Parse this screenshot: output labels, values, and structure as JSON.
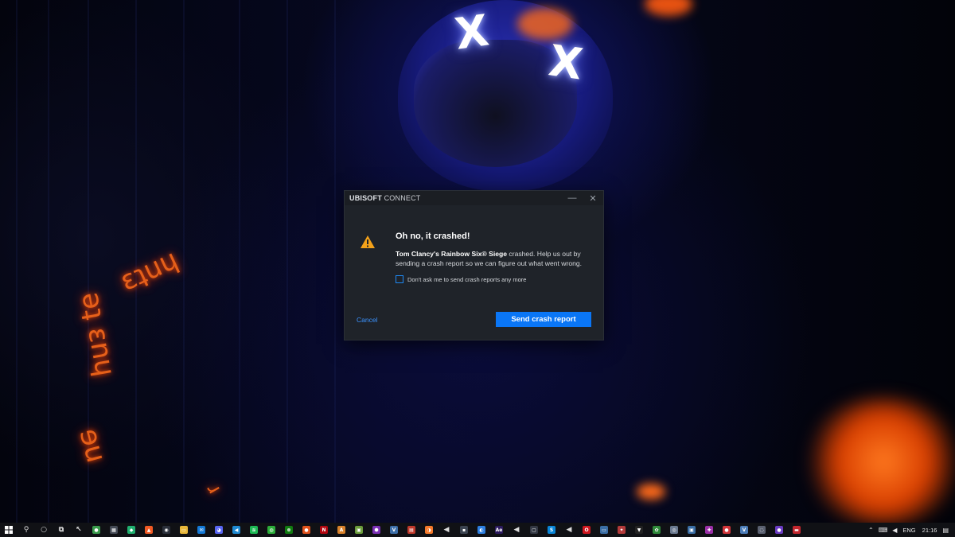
{
  "dialog": {
    "brand_bold": "UBISOFT",
    "brand_rest": " CONNECT",
    "minimize_glyph": "—",
    "close_glyph": "✕",
    "heading": "Oh no, it crashed!",
    "game_name": "Tom Clancy's Rainbow Six® Siege",
    "message_rest": " crashed. Help us out by sending a crash report so we can figure out what went wrong.",
    "checkbox_label": "Don't ask me to send crash reports any more",
    "checkbox_checked": false,
    "cancel_label": "Cancel",
    "send_label": "Send crash report",
    "accent_color": "#0a76f6",
    "warning_color": "#f4a21a"
  },
  "wallpaper": {
    "mask_eye_left": "X",
    "mask_eye_right": "X"
  },
  "taskbar": {
    "apps": [
      {
        "name": "search-icon",
        "glyph": "⚲",
        "color": "transparent"
      },
      {
        "name": "cortana-icon",
        "glyph": "○",
        "color": "transparent"
      },
      {
        "name": "task-view-icon",
        "glyph": "⧉",
        "color": "transparent"
      },
      {
        "name": "cursor-app-icon",
        "glyph": "↖",
        "color": "transparent"
      },
      {
        "name": "chrome-icon",
        "glyph": "●",
        "color": "#3a9b4c"
      },
      {
        "name": "calculator-icon",
        "glyph": "▦",
        "color": "#444a55"
      },
      {
        "name": "app-green-icon",
        "glyph": "◆",
        "color": "#20b070"
      },
      {
        "name": "brave-icon",
        "glyph": "▲",
        "color": "#f15a24"
      },
      {
        "name": "app-eye-icon",
        "glyph": "◉",
        "color": "#2a2f3a"
      },
      {
        "name": "file-explorer-icon",
        "glyph": "▭",
        "color": "#e8b73a"
      },
      {
        "name": "mail-icon",
        "glyph": "✉",
        "color": "#1479d6"
      },
      {
        "name": "discord-icon",
        "glyph": "◕",
        "color": "#5865f2"
      },
      {
        "name": "vscode-icon",
        "glyph": "◀",
        "color": "#1f8ad2"
      },
      {
        "name": "spotify-icon",
        "glyph": "≋",
        "color": "#1db954"
      },
      {
        "name": "xbox-green-icon",
        "glyph": "◍",
        "color": "#2cae3a"
      },
      {
        "name": "xbox-icon",
        "glyph": "⊗",
        "color": "#107c10"
      },
      {
        "name": "app-orange-icon",
        "glyph": "●",
        "color": "#e0521c"
      },
      {
        "name": "netflix-icon",
        "glyph": "N",
        "color": "#b20710"
      },
      {
        "name": "app-a-icon",
        "glyph": "A",
        "color": "#d9822b"
      },
      {
        "name": "minecraft-icon",
        "glyph": "▣",
        "color": "#6a9c3a"
      },
      {
        "name": "app-purple-icon",
        "glyph": "⬢",
        "color": "#7b2fb5"
      },
      {
        "name": "app-v-icon",
        "glyph": "V",
        "color": "#3c6ea8"
      },
      {
        "name": "app-red-badge-icon",
        "glyph": "▤",
        "color": "#c0392b"
      },
      {
        "name": "blender-icon",
        "glyph": "◑",
        "color": "#f5792a"
      },
      {
        "name": "speaker-icon",
        "glyph": "◀",
        "color": "transparent"
      },
      {
        "name": "app-dark-icon",
        "glyph": "▪",
        "color": "#3b4350"
      },
      {
        "name": "app-blue-circle-icon",
        "glyph": "◐",
        "color": "#2d7fe0"
      },
      {
        "name": "after-effects-icon",
        "glyph": "Ae",
        "color": "#2b1a5e"
      },
      {
        "name": "speaker-2-icon",
        "glyph": "◀",
        "color": "transparent"
      },
      {
        "name": "app-box-icon",
        "glyph": "▢",
        "color": "#333844"
      },
      {
        "name": "app-skype-icon",
        "glyph": "S",
        "color": "#0a86d8"
      },
      {
        "name": "speaker-3-icon",
        "glyph": "◀",
        "color": "transparent"
      },
      {
        "name": "opera-icon",
        "glyph": "O",
        "color": "#d0161f"
      },
      {
        "name": "app-monitor-icon",
        "glyph": "▭",
        "color": "#3b6ea5"
      },
      {
        "name": "app-game-icon",
        "glyph": "✦",
        "color": "#b33a3a"
      },
      {
        "name": "app-triangle-icon",
        "glyph": "▼",
        "color": "#222"
      },
      {
        "name": "app-leaf-icon",
        "glyph": "✿",
        "color": "#2f8a3a"
      },
      {
        "name": "ubisoft-icon",
        "glyph": "◎",
        "color": "#6b7a90"
      },
      {
        "name": "app-window-icon",
        "glyph": "▣",
        "color": "#3a6ea5"
      },
      {
        "name": "app-pink-icon",
        "glyph": "✚",
        "color": "#9b2fa8"
      },
      {
        "name": "app-rec-icon",
        "glyph": "●",
        "color": "#d2353a"
      },
      {
        "name": "vegas-icon",
        "glyph": "V",
        "color": "#4b7cb8"
      },
      {
        "name": "app-globe-icon",
        "glyph": "◌",
        "color": "#5a6070"
      },
      {
        "name": "app-violet-icon",
        "glyph": "●",
        "color": "#6a3bc2"
      },
      {
        "name": "app-red-small-icon",
        "glyph": "▬",
        "color": "#c3262e"
      }
    ],
    "tray": {
      "chevron": "⌃",
      "keyboard": "⌨",
      "volume": "◀",
      "language": "ENG",
      "time": "21:16",
      "notifications": "▤"
    }
  }
}
